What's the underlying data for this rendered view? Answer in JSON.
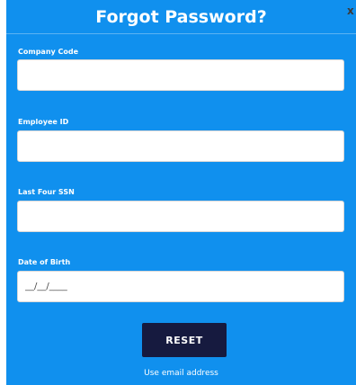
{
  "modal": {
    "title": "Forgot Password?",
    "close_icon": "close-icon",
    "close_glyph": "x"
  },
  "fields": {
    "company_code": {
      "label": "Company Code",
      "value": "",
      "placeholder": ""
    },
    "employee_id": {
      "label": "Employee ID",
      "value": "",
      "placeholder": ""
    },
    "last_four_ssn": {
      "label": "Last Four SSN",
      "value": "",
      "placeholder": ""
    },
    "date_of_birth": {
      "label": "Date of Birth",
      "value": "",
      "placeholder": "__/__/____"
    }
  },
  "actions": {
    "reset_label": "RESET",
    "alt_link_label": "Use email address"
  },
  "colors": {
    "modal_background": "#1090ee",
    "button_background": "#161a3f",
    "text": "#ffffff"
  }
}
